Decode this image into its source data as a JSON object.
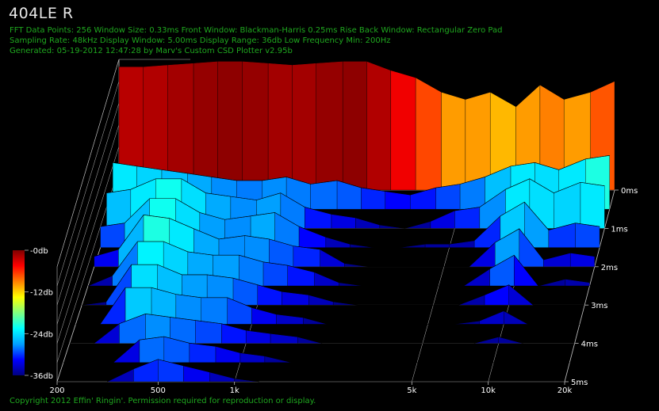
{
  "header": {
    "title": "404LE R",
    "line1": "FFT Data Points: 256  Window Size: 0.33ms   Front Window: Blackman-Harris 0.25ms Rise   Back Window: Rectangular Zero Pad",
    "line2": "Sampling Rate: 48kHz  Display Window: 5.00ms   Display Range: 36db  Low Frequency Min: 200Hz",
    "line3": "Generated: 05-19-2012 12:47:28 by Marv's Custom CSD Plotter v2.95b"
  },
  "footer": "Copyright 2012 Effin' Ringin'. Permission required for reproduction or display.",
  "colors": {
    "background": "#000000",
    "meta_text": "#1fa81f",
    "grid": "#bbbbbb",
    "colormap": [
      "#000080",
      "#0000ff",
      "#00a0ff",
      "#00ffff",
      "#80ff80",
      "#ffff00",
      "#ff8000",
      "#ff0000",
      "#800000"
    ]
  },
  "chart_data": {
    "type": "waterfall",
    "title": "404LE R",
    "x_axis": {
      "label": "",
      "scale": "log",
      "range": [
        200,
        20000
      ],
      "ticks": [
        200,
        500,
        1000,
        5000,
        10000,
        20000
      ],
      "tick_labels": [
        "200",
        "500",
        "1k",
        "5k",
        "10k",
        "20k"
      ]
    },
    "time_axis": {
      "label": "",
      "range_ms": [
        0,
        5
      ],
      "ticks": [
        0,
        1,
        2,
        3,
        4,
        5
      ],
      "tick_labels": [
        "0ms",
        "1ms",
        "2ms",
        "3ms",
        "4ms",
        "5ms"
      ]
    },
    "z_axis": {
      "label": "",
      "unit": "db",
      "range": [
        -36,
        0
      ],
      "colorbar_ticks": [
        0,
        -12,
        -24,
        -36
      ],
      "colorbar_labels": [
        "-0db",
        "-12db",
        "-24db",
        "-36db"
      ]
    },
    "frequencies_hz": [
      200,
      250,
      315,
      400,
      500,
      630,
      800,
      1000,
      1250,
      1600,
      2000,
      2500,
      3150,
      4000,
      5000,
      6300,
      8000,
      10000,
      12500,
      16000,
      20000
    ],
    "slices": [
      {
        "t_ms": 0.0,
        "level_db": [
          -2,
          -2,
          -1.5,
          -1,
          -0.5,
          -0.5,
          -1,
          -1.5,
          -1,
          -0.5,
          -0.5,
          -3,
          -5,
          -9,
          -11,
          -9,
          -13,
          -7,
          -11,
          -9,
          -6
        ]
      },
      {
        "t_ms": 0.5,
        "level_db": [
          -23,
          -24,
          -25,
          -26,
          -27,
          -28,
          -28,
          -27,
          -29,
          -28,
          -30,
          -31,
          -32,
          -30,
          -29,
          -27,
          -24,
          -23,
          -25,
          -22,
          -21
        ]
      },
      {
        "t_ms": 1.0,
        "level_db": [
          -26,
          -25,
          -22,
          -22,
          -26,
          -27,
          -28,
          -26,
          -30,
          -32,
          -33,
          -35,
          -36,
          -34,
          -31,
          -30,
          -25,
          -22,
          -26,
          -23,
          -24
        ]
      },
      {
        "t_ms": 1.5,
        "level_db": [
          -30,
          -29,
          -22,
          -22,
          -26,
          -28,
          -27,
          -26,
          -30,
          -33,
          -35,
          -36,
          -36,
          -35,
          -35,
          -34,
          -27,
          -23,
          -31,
          -29,
          -30
        ]
      },
      {
        "t_ms": 2.0,
        "level_db": [
          -33,
          -31,
          -21,
          -22,
          -25,
          -28,
          -27,
          -28,
          -30,
          -31,
          -35,
          -36,
          -36,
          -36,
          -36,
          -36,
          -29,
          -25,
          -34,
          -32,
          -33
        ]
      },
      {
        "t_ms": 2.5,
        "level_db": [
          -36,
          -33,
          -23,
          -23,
          -26,
          -27,
          -27,
          -29,
          -30,
          -32,
          -35,
          -36,
          -36,
          -36,
          -36,
          -36,
          -31,
          -27,
          -36,
          -34,
          -35
        ]
      },
      {
        "t_ms": 3.0,
        "level_db": [
          -36,
          -35,
          -24,
          -24,
          -27,
          -27,
          -28,
          -30,
          -32,
          -33,
          -35,
          -36,
          -36,
          -36,
          -36,
          -36,
          -33,
          -30,
          -36,
          -36,
          -36
        ]
      },
      {
        "t_ms": 3.5,
        "level_db": [
          -36,
          -36,
          -25,
          -25,
          -27,
          -28,
          -28,
          -31,
          -33,
          -34,
          -36,
          -36,
          -36,
          -36,
          -36,
          -36,
          -35,
          -32,
          -36,
          -36,
          -36
        ]
      },
      {
        "t_ms": 4.0,
        "level_db": [
          -36,
          -36,
          -30,
          -27,
          -28,
          -29,
          -30,
          -32,
          -33,
          -34,
          -36,
          -36,
          -36,
          -36,
          -36,
          -36,
          -36,
          -34,
          -36,
          -36,
          -36
        ]
      },
      {
        "t_ms": 4.5,
        "level_db": [
          -36,
          -36,
          -36,
          -29,
          -28,
          -30,
          -31,
          -33,
          -34,
          -36,
          -36,
          -36,
          -36,
          -36,
          -36,
          -36,
          -36,
          -36,
          -36,
          -36,
          -36
        ]
      },
      {
        "t_ms": 5.0,
        "level_db": [
          -36,
          -36,
          -36,
          -32,
          -29,
          -31,
          -33,
          -35,
          -36,
          -36,
          -36,
          -36,
          -36,
          -36,
          -36,
          -36,
          -36,
          -36,
          -36,
          -36,
          -36
        ]
      }
    ]
  }
}
